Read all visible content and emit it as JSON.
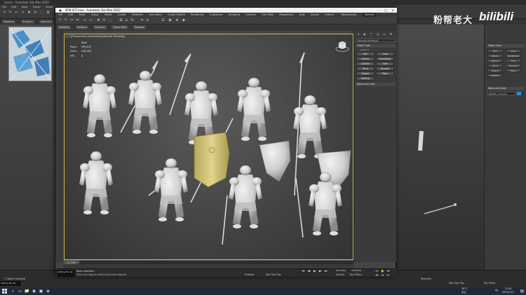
{
  "bg_window": {
    "title": "Lonce - Autodesk 3ds Max 2022",
    "menu": [
      "File",
      "Edit",
      "Tools",
      "Group",
      "Views",
      "Create",
      "Modifiers",
      "Animation",
      "Graph Editors",
      "Rendering",
      "Customize",
      "Scripting",
      "Content",
      "Civil View",
      "Megascans",
      "Help",
      "Arnold",
      "Octane"
    ],
    "ribbon": [
      "Modeling",
      "Freeform",
      "Selection",
      "Object Paint",
      "Populate"
    ],
    "ribbon_sub": "Polygon Modeling",
    "command_panel": {
      "object_type": "Object Type",
      "buttons": [
        "Box",
        "Cone",
        "Sphere",
        "GeoSphere",
        "Cylinder",
        "Tube",
        "Torus",
        "Pyramid",
        "Teapot",
        "Plane",
        "TextPlus"
      ],
      "name_and_color": "Name and Color",
      "name_value": "Bip001 L Clavicle"
    },
    "status_selected": "1 Object Selected",
    "status_prompt": "Click and drag to select and move objects",
    "maxscript": "Getting Be Ver",
    "selected_label": "Selected",
    "add_time_tag": "Add Time Tag",
    "set_key": "Set Key",
    "key_filters": "Key Filters..."
  },
  "watermark": {
    "text": "粉帮老大",
    "logo": "bilibili"
  },
  "main_window": {
    "title": "SFM-SYT.max - Autodesk 3ds Max 2022",
    "menu": [
      "File",
      "Edit",
      "Tools",
      "Group",
      "Views",
      "Create",
      "Modifiers",
      "Animation",
      "Graph Editors",
      "Rendering",
      "Customize",
      "Scripting",
      "Content",
      "Civil View",
      "Megascans",
      "Help",
      "Arnold",
      "Octane"
    ],
    "workspace_label": "Workspaces:",
    "workspace_value": "Default",
    "ribbon": [
      "Modeling",
      "Freeform",
      "Selection",
      "Object Paint",
      "Populate"
    ],
    "viewport_label": "[+] [Perspective] [Standard] [Default Shading]",
    "stats": {
      "header": "Total",
      "polys_label": "Polys:",
      "polys_value": "993,632",
      "verts_label": "Verts:",
      "verts_value": "518,283",
      "fps_label": "FPS:",
      "fps_value": "8"
    },
    "command_panel": {
      "dropdown": "Standard Primitives",
      "object_type": "Object Type",
      "autogrid": "AutoGrid",
      "buttons": [
        "Box",
        "Cone",
        "Sphere",
        "GeoSphere",
        "Cylinder",
        "Tube",
        "Torus",
        "Pyramid",
        "Teapot",
        "Plane",
        "TextPlus"
      ],
      "name_and_color": "Name and Color"
    },
    "time_slider": "0 / 100",
    "status_selected": "None Selected",
    "status_prompt": "Click and drag to select and move objects",
    "maxscript": "Getting Be Ver",
    "selected_label": "Selected",
    "add_time_tag": "Add Time Tag",
    "set_key": "Set Key",
    "auto_key": "Auto Key",
    "key_filters": "Key Filters...",
    "enabled": "Enabled:"
  },
  "taskbar": {
    "temp": "28°C",
    "weather": "多云",
    "lang": "中",
    "time": "22:09",
    "date": "2024/7/21"
  },
  "colors": {
    "selection_highlight": "#d8b94a",
    "shield_selected": "#cfc07a",
    "knight_white": "#d9d9d9"
  }
}
